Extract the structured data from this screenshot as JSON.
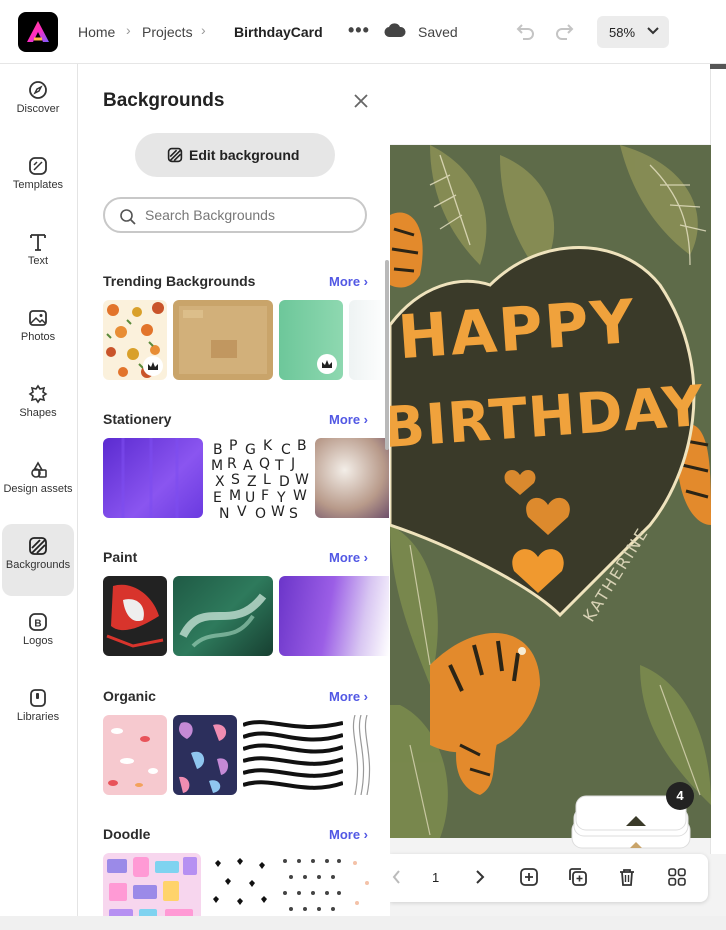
{
  "breadcrumb": {
    "home": "Home",
    "projects": "Projects",
    "document": "BirthdayCard"
  },
  "status": {
    "saved": "Saved"
  },
  "zoom": {
    "value": "58%"
  },
  "rail": [
    {
      "label": "Discover",
      "icon": "discover-icon"
    },
    {
      "label": "Templates",
      "icon": "templates-icon"
    },
    {
      "label": "Text",
      "icon": "text-icon"
    },
    {
      "label": "Photos",
      "icon": "photos-icon"
    },
    {
      "label": "Shapes",
      "icon": "shapes-icon"
    },
    {
      "label": "Design assets",
      "icon": "design-assets-icon"
    },
    {
      "label": "Backgrounds",
      "icon": "backgrounds-icon",
      "active": true
    },
    {
      "label": "Logos",
      "icon": "logos-icon"
    },
    {
      "label": "Libraries",
      "icon": "libraries-icon"
    }
  ],
  "panel": {
    "title": "Backgrounds",
    "edit_button": "Edit background",
    "search_placeholder": "Search Backgrounds",
    "sections": [
      {
        "title": "Trending Backgrounds",
        "more": "More ›"
      },
      {
        "title": "Stationery",
        "more": "More ›"
      },
      {
        "title": "Paint",
        "more": "More ›"
      },
      {
        "title": "Organic",
        "more": "More ›"
      },
      {
        "title": "Doodle",
        "more": "More ›"
      }
    ]
  },
  "card": {
    "line1": "HAPPY",
    "line2": "BIRTHDAY",
    "signature": "KATHERINE"
  },
  "pager": {
    "page": "1",
    "page_count": "4"
  },
  "colors": {
    "accent": "#5258e4",
    "card_green": "#5e6b49",
    "heart_dark": "#3a3a29",
    "lettering": "#f0a23c"
  }
}
